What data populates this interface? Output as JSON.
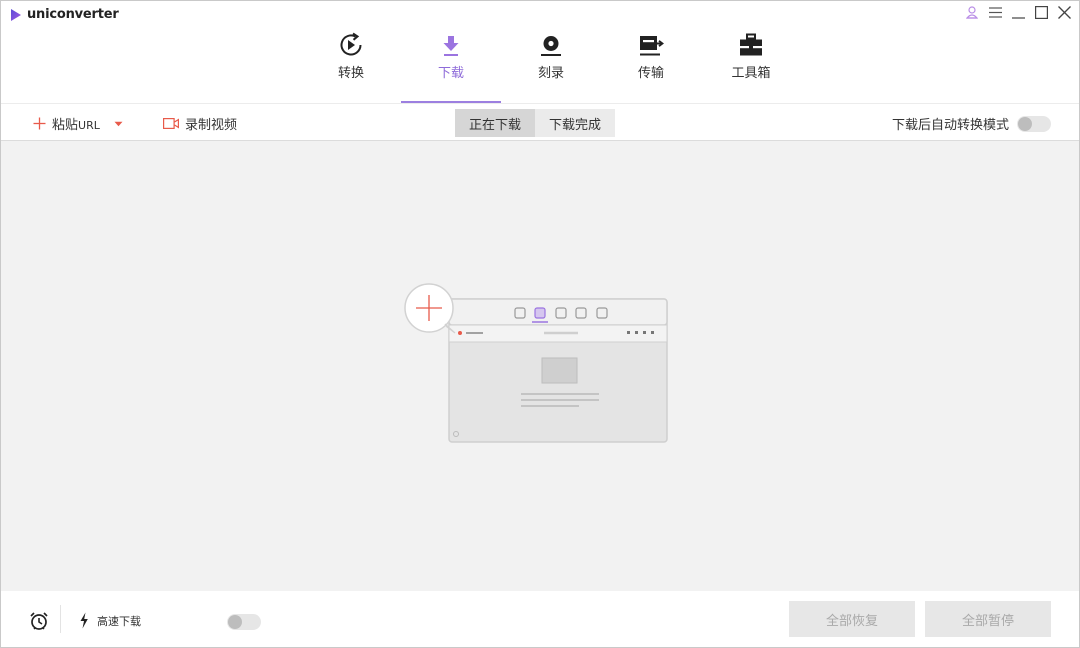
{
  "app": {
    "name": "uniconverter"
  },
  "nav": [
    {
      "id": "convert",
      "label": "转换",
      "icon": "convert-icon"
    },
    {
      "id": "download",
      "label": "下载",
      "icon": "download-icon",
      "active": true
    },
    {
      "id": "burn",
      "label": "刻录",
      "icon": "burn-disc-icon"
    },
    {
      "id": "transfer",
      "label": "传输",
      "icon": "transfer-icon"
    },
    {
      "id": "toolbox",
      "label": "工具箱",
      "icon": "toolbox-icon"
    }
  ],
  "toolbar": {
    "paste_label": "粘贴",
    "paste_url": "URL",
    "record_label": "录制视频",
    "tabs": [
      {
        "label": "正在下载",
        "active": true
      },
      {
        "label": "下载完成",
        "active": false
      }
    ],
    "auto_convert_label": "下载后自动转换模式",
    "auto_convert_on": false
  },
  "bottom": {
    "high_speed_label": "高速下载",
    "high_speed_on": false,
    "resume_all_label": "全部恢复",
    "pause_all_label": "全部暂停"
  },
  "colors": {
    "accent": "#8e6bd9",
    "add": "#e85a4a",
    "content_bg": "#f2f2f2"
  }
}
